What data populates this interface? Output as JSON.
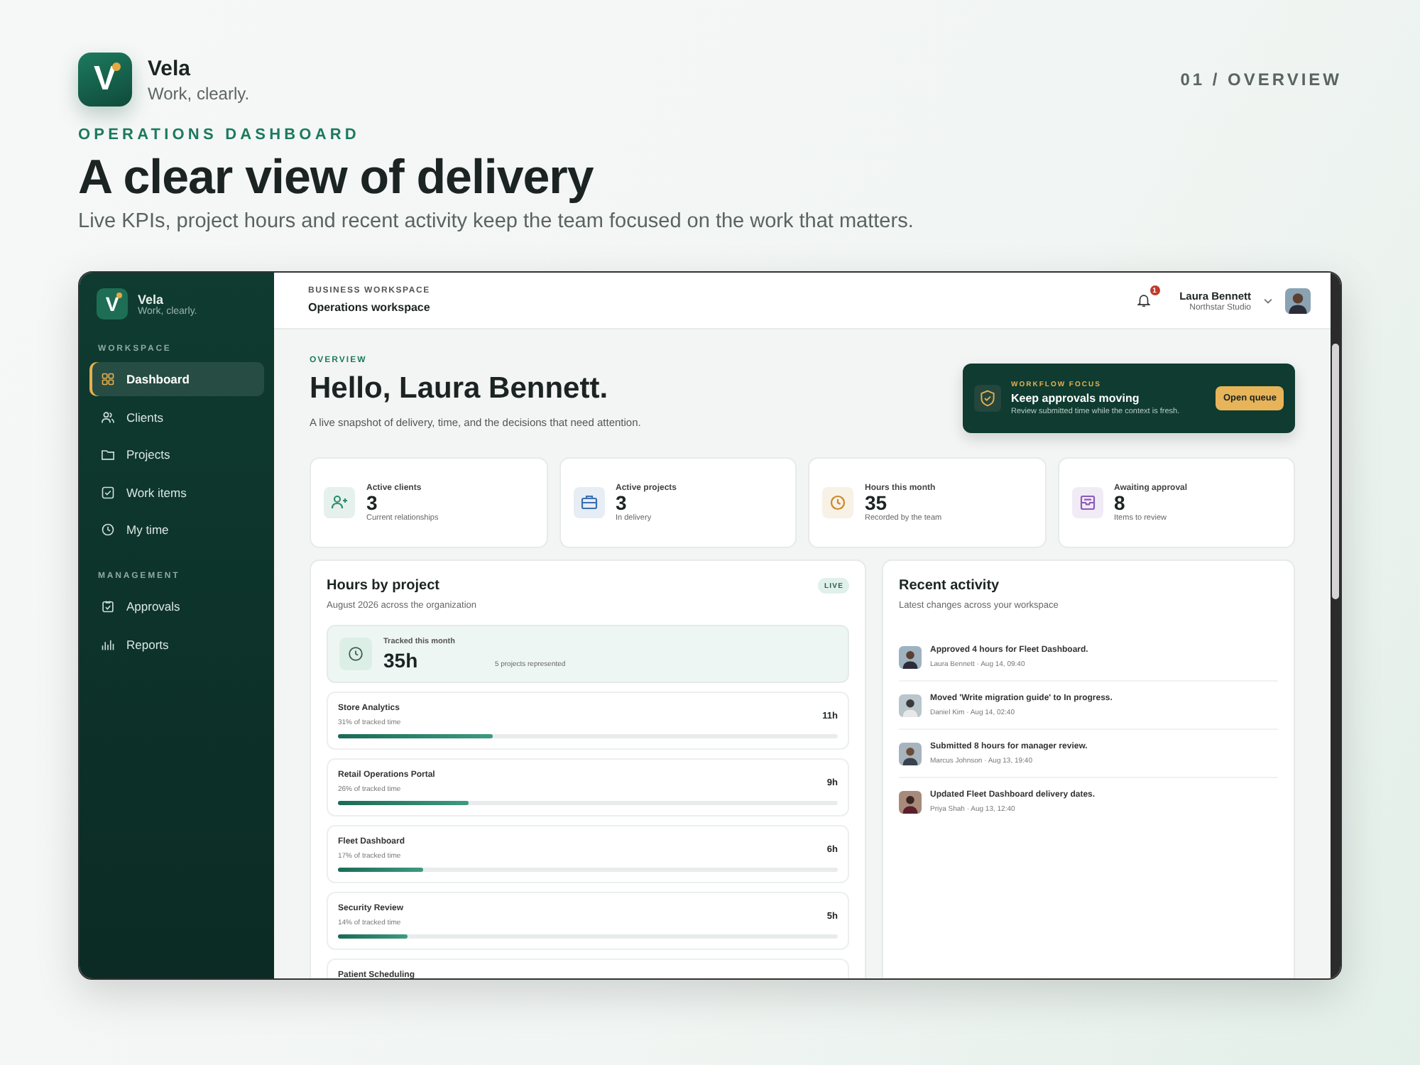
{
  "brand": {
    "mark": "V",
    "name": "Vela",
    "tagline": "Work, clearly."
  },
  "page_label": "01 / OVERVIEW",
  "eyebrow": "OPERATIONS DASHBOARD",
  "headline": "A clear view of delivery",
  "subheadline": "Live KPIs, project hours and recent activity keep the team focused on the work that matters.",
  "app": {
    "sidebar": {
      "brand": {
        "mark": "V",
        "name": "Vela",
        "tagline": "Work, clearly."
      },
      "sections": [
        {
          "title": "WORKSPACE",
          "items": [
            {
              "label": "Dashboard",
              "selected": true
            },
            {
              "label": "Clients",
              "selected": false
            },
            {
              "label": "Projects",
              "selected": false
            },
            {
              "label": "Work items",
              "selected": false
            },
            {
              "label": "My time",
              "selected": false
            }
          ]
        },
        {
          "title": "MANAGEMENT",
          "items": [
            {
              "label": "Approvals",
              "selected": false
            },
            {
              "label": "Reports",
              "selected": false
            }
          ]
        }
      ]
    },
    "topbar": {
      "eyebrow": "BUSINESS WORKSPACE",
      "title": "Operations workspace",
      "notifications": "1",
      "user": {
        "name": "Laura Bennett",
        "org": "Northstar Studio"
      }
    },
    "overview": {
      "eyebrow": "OVERVIEW",
      "greeting": "Hello, Laura Bennett.",
      "summary": "A live snapshot of delivery, time, and the decisions that need attention."
    },
    "focus": {
      "eyebrow": "WORKFLOW FOCUS",
      "title": "Keep approvals moving",
      "text": "Review submitted time while the context is fresh.",
      "button": "Open queue"
    },
    "stats": [
      {
        "label": "Active clients",
        "value": "3",
        "note": "Current relationships",
        "color": "#2e8b6e"
      },
      {
        "label": "Active projects",
        "value": "3",
        "note": "In delivery",
        "color": "#3b6fb0"
      },
      {
        "label": "Hours this month",
        "value": "35",
        "note": "Recorded by the team",
        "color": "#c8892a"
      },
      {
        "label": "Awaiting approval",
        "value": "8",
        "note": "Items to review",
        "color": "#8a5bb8"
      }
    ],
    "hours": {
      "title": "Hours by project",
      "subtitle": "August 2026 across the organization",
      "badge": "LIVE",
      "total_label": "Tracked this month",
      "total": "35h",
      "total_note": "5 projects represented",
      "projects": [
        {
          "name": "Store Analytics",
          "share": "31% of tracked time",
          "hours": "11h",
          "level": 0.31
        },
        {
          "name": "Retail Operations Portal",
          "share": "26% of tracked time",
          "hours": "9h",
          "level": 0.26
        },
        {
          "name": "Fleet Dashboard",
          "share": "17% of tracked time",
          "hours": "6h",
          "level": 0.17
        },
        {
          "name": "Security Review",
          "share": "14% of tracked time",
          "hours": "5h",
          "level": 0.14
        },
        {
          "name": "Patient Scheduling"
        }
      ]
    },
    "activity": {
      "title": "Recent activity",
      "subtitle": "Latest changes across your workspace",
      "items": [
        {
          "text": "Approved 4 hours for Fleet Dashboard.",
          "meta": "Laura Bennett · Aug 14, 09:40"
        },
        {
          "text": "Moved 'Write migration guide' to In progress.",
          "meta": "Daniel Kim · Aug 14, 02:40"
        },
        {
          "text": "Submitted 8 hours for manager review.",
          "meta": "Marcus Johnson · Aug 13, 19:40"
        },
        {
          "text": "Updated Fleet Dashboard delivery dates.",
          "meta": "Priya Shah · Aug 13, 12:40"
        }
      ]
    }
  }
}
